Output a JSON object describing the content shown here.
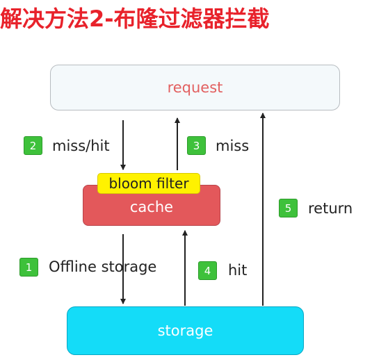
{
  "title": "解决方法2-布隆过滤器拦截",
  "nodes": {
    "request": "request",
    "bloom_filter": "bloom filter",
    "cache": "cache",
    "storage": "storage"
  },
  "steps": [
    {
      "number": "1",
      "label": "Offline storage"
    },
    {
      "number": "2",
      "label": "miss/hit"
    },
    {
      "number": "3",
      "label": "miss"
    },
    {
      "number": "4",
      "label": "hit"
    },
    {
      "number": "5",
      "label": "return"
    }
  ],
  "colors": {
    "title": "#e8222b",
    "request_text": "#e26060",
    "cache_fill": "#e3585b",
    "bloom_fill": "#fff200",
    "storage_fill": "#14dcf8",
    "badge_fill": "#3ec13b"
  }
}
